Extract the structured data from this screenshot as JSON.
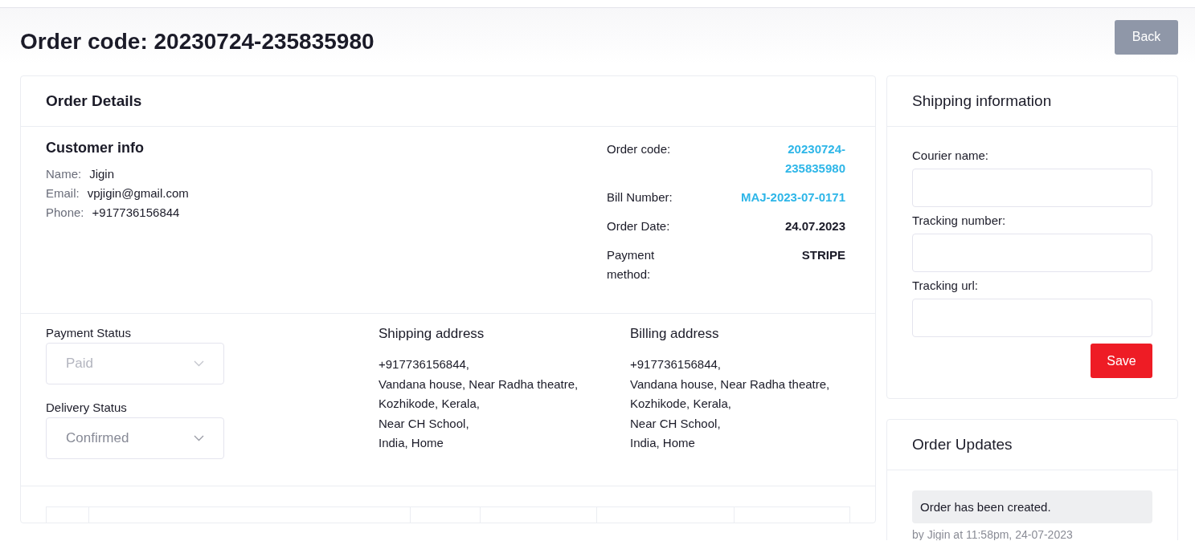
{
  "title": "Order code: 20230724-235835980",
  "back_button": "Back",
  "order_details": {
    "title": "Order Details",
    "customer_info": {
      "title": "Customer info",
      "fields": [
        {
          "label": "Name:",
          "value": "Jigin"
        },
        {
          "label": "Email:",
          "value": "vpjigin@gmail.com"
        },
        {
          "label": "Phone:",
          "value": "+917736156844"
        }
      ]
    },
    "summary": [
      {
        "label": "Order code:",
        "value": "20230724-235835980",
        "kind": "link"
      },
      {
        "label": "Bill Number:",
        "value": "MAJ-2023-07-0171",
        "kind": "link"
      },
      {
        "label": "Order Date:",
        "value": "24.07.2023",
        "kind": "plain"
      },
      {
        "label": "Payment method:",
        "value": "STRIPE",
        "kind": "plain"
      }
    ],
    "statuses": [
      {
        "label": "Payment Status",
        "value": "Paid",
        "disabled": true
      },
      {
        "label": "Delivery Status",
        "value": "Confirmed",
        "disabled": false
      }
    ],
    "addresses": [
      {
        "title": "Shipping address",
        "lines": [
          "+917736156844,",
          "Vandana house, Near Radha theatre,",
          "Kozhikode, Kerala,",
          "Near CH School,",
          "India, Home"
        ]
      },
      {
        "title": "Billing address",
        "lines": [
          "+917736156844,",
          "Vandana house, Near Radha theatre,",
          "Kozhikode, Kerala,",
          "Near CH School,",
          "India, Home"
        ]
      }
    ]
  },
  "shipping_information": {
    "title": "Shipping information",
    "fields": [
      {
        "label": "Courier name:"
      },
      {
        "label": "Tracking number:"
      },
      {
        "label": "Tracking url:"
      }
    ],
    "save_button": "Save"
  },
  "order_updates": {
    "title": "Order Updates",
    "items": [
      {
        "message": "Order has been created.",
        "meta": "by Jigin at 11:58pm, 24-07-2023"
      }
    ]
  }
}
